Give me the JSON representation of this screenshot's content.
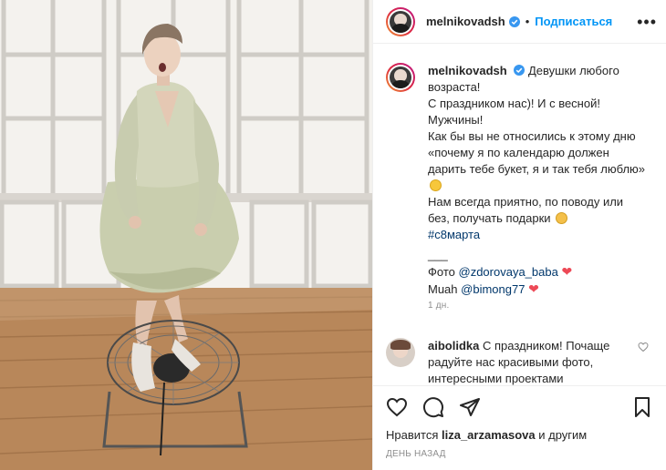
{
  "post": {
    "author": "melnikovadsh",
    "follow_label": "Подписаться",
    "dot": "•",
    "more": "•••"
  },
  "caption": {
    "username": "melnikovadsh",
    "line1": "Девушки любого возраста!",
    "line2": "С праздником нас)! И с весной!",
    "line3": "Мужчины!",
    "line4": "Как бы вы не относились к этому дню «почему я по календарю должен дарить тебе букет, я и так тебя люблю»",
    "line5": "Нам всегда приятно, по поводу или без, получать подарки",
    "hashtag": "#с8марта",
    "separator": "___",
    "photo_prefix": "Фото",
    "photo_mention": "@zdorovaya_baba",
    "muah_prefix": "Muah",
    "muah_mention": "@bimong77",
    "time": "1 дн."
  },
  "comment": {
    "username": "aibolidka",
    "text": "С праздником! Почаще радуйте нас красивыми фото, интересными проектами"
  },
  "footer": {
    "likes_prefix": "Нравится",
    "likes_user": "liza_arzamasova",
    "likes_suffix": "и другим",
    "date": "ДЕНЬ НАЗАД"
  },
  "icons": {
    "like": "heart-icon",
    "comment": "comment-icon",
    "share": "paper-plane-icon",
    "save": "bookmark-icon",
    "verified": "verified-badge-icon"
  },
  "colors": {
    "link": "#00376b",
    "follow": "#0095f6",
    "heart": "#ed4956",
    "muted": "#8e8e8e",
    "dress": "#c9ceae"
  }
}
